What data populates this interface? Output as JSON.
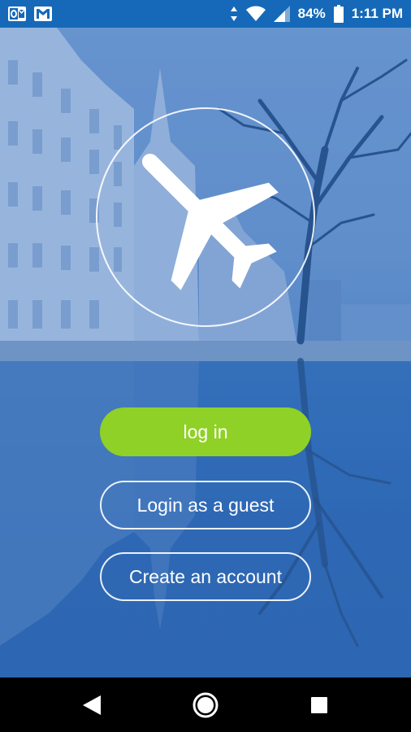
{
  "status_bar": {
    "battery": "84%",
    "time": "1:11 PM",
    "notification_icons": [
      "outlook-icon",
      "gmail-icon"
    ],
    "system_icons": [
      "data-arrows-icon",
      "wifi-icon",
      "signal-icon",
      "battery-icon"
    ],
    "background_color": "#1569b8"
  },
  "brand": {
    "logo_icon": "airplane-icon"
  },
  "actions": {
    "login_label": "log in",
    "guest_label": "Login as a guest",
    "create_label": "Create an account",
    "login_color": "#8fd126"
  },
  "nav_bar": {
    "icons": [
      "back-icon",
      "home-icon",
      "recents-icon"
    ]
  }
}
